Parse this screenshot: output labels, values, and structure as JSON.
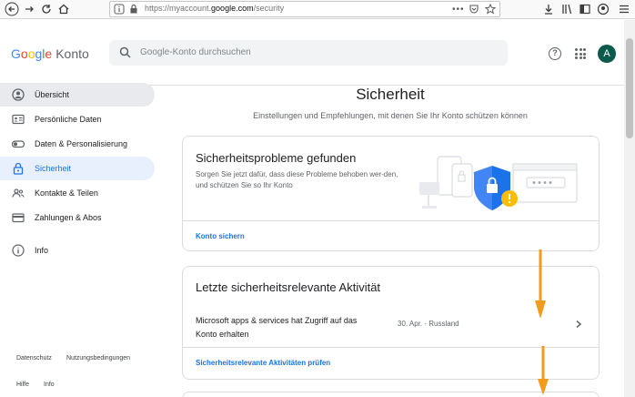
{
  "browser": {
    "url_prefix": "https://myaccount.",
    "url_domain": "google.com",
    "url_path": "/security",
    "icons": [
      "back-icon",
      "forward-icon",
      "reload-icon",
      "home-icon",
      "info-icon",
      "lock-icon",
      "more-icon",
      "pocket-icon",
      "bookmark-star-icon",
      "download-icon",
      "library-icon",
      "sidebar-icon",
      "account-icon",
      "menu-icon"
    ]
  },
  "header": {
    "logo_letters": [
      "G",
      "o",
      "o",
      "g",
      "l",
      "e"
    ],
    "product": "Konto",
    "search_placeholder": "Google-Konto durchsuchen",
    "avatar_letter": "A"
  },
  "sidebar": {
    "items": [
      {
        "label": "Übersicht",
        "icon": "person-circle-icon",
        "state": "hover"
      },
      {
        "label": "Persönliche Daten",
        "icon": "id-card-icon",
        "state": "normal"
      },
      {
        "label": "Daten & Personalisierung",
        "icon": "toggle-icon",
        "state": "normal"
      },
      {
        "label": "Sicherheit",
        "icon": "lock-icon",
        "state": "selected"
      },
      {
        "label": "Kontakte & Teilen",
        "icon": "people-icon",
        "state": "normal"
      },
      {
        "label": "Zahlungen & Abos",
        "icon": "credit-card-icon",
        "state": "normal"
      },
      {
        "label": "Info",
        "icon": "info-circle-icon",
        "state": "normal"
      }
    ],
    "footer": {
      "privacy": "Datenschutz",
      "terms": "Nutzungsbedingungen",
      "help": "Hilfe",
      "info": "Info"
    }
  },
  "main": {
    "title": "Sicherheit",
    "subtitle": "Einstellungen und Empfehlungen, mit denen Sie Ihr Konto schützen können",
    "issues_card": {
      "title": "Sicherheitsprobleme gefunden",
      "description": "Sorgen Sie jetzt dafür, dass diese Probleme behoben wer-den, und schützen Sie so Ihr Konto",
      "link": "Konto sichern"
    },
    "activity_card": {
      "title": "Letzte sicherheitsrelevante Aktivität",
      "item_text": "Microsoft apps & services hat Zugriff auf das Konto erhalten",
      "item_meta": "30. Apr. · Russland",
      "link": "Sicherheitsrelevante Aktivitäten prüfen"
    }
  },
  "colors": {
    "accent": "#1a73e8",
    "arrow": "#f29b1d",
    "shield": "#4285f4",
    "warning": "#fbbc04"
  }
}
